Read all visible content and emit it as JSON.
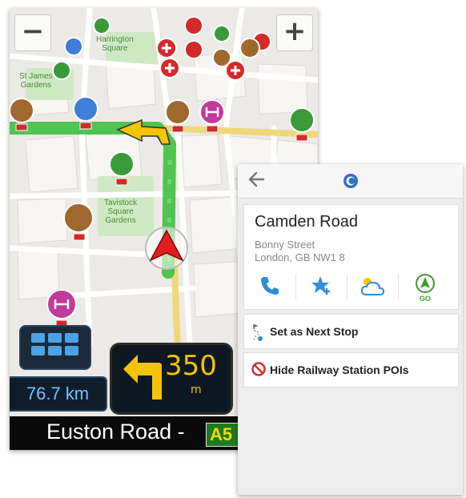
{
  "map": {
    "zoom_out_label": "−",
    "zoom_in_label": "+",
    "labels": {
      "harrington": "Harrington\nSquare",
      "st_james": "St James\nGardens",
      "tavistock": "Tavistock\nSquare\nGardens"
    }
  },
  "navigation": {
    "remaining_distance": "76.7 km",
    "turn_distance": "350",
    "turn_unit": "m",
    "street_name": "Euston Road -",
    "road_number": "A5"
  },
  "poi_panel": {
    "title": "Camden Road",
    "street": "Bonny Street",
    "city": "London, GB NW1 8",
    "actions": {
      "go_label": "GO"
    },
    "set_next_stop": "Set as Next Stop",
    "hide_pois": "Hide Railway Station POIs"
  },
  "colors": {
    "route": "#3fbf3f",
    "accent": "#2f8fd6",
    "hospital": "#d42a2a",
    "hotel": "#c23a9a",
    "park": "#cfe8c4"
  }
}
